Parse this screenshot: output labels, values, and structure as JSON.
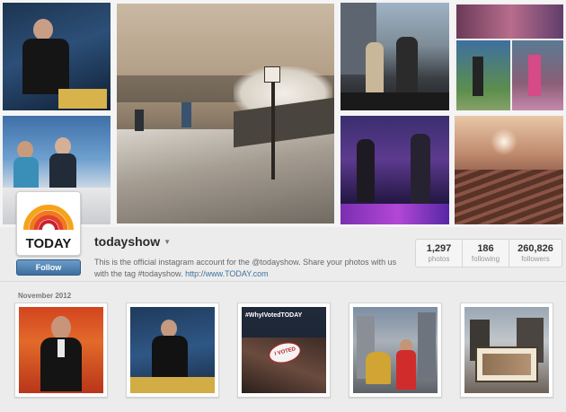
{
  "profile": {
    "username": "todayshow",
    "bio_text": "This is the official instagram account for the @todayshow. Share your photos with us with the tag #todayshow. ",
    "bio_link": "http://www.TODAY.com",
    "follow_label": "Follow",
    "avatar_logo_text": "TODAY"
  },
  "stats": [
    {
      "value": "1,297",
      "label": "photos"
    },
    {
      "value": "186",
      "label": "following"
    },
    {
      "value": "260,826",
      "label": "followers"
    }
  ],
  "section_label": "November 2012",
  "photos": [
    {
      "name": "photo-man-in-suit"
    },
    {
      "name": "photo-man-on-set"
    },
    {
      "name": "photo-why-i-voted",
      "caption": "#WhyIVotedTODAY",
      "sticker": "I VOTED"
    },
    {
      "name": "photo-woman-red-coat"
    },
    {
      "name": "photo-outdoor-crowd"
    }
  ],
  "colors": {
    "accent_link": "#3f729b",
    "follow_button": "#3d6f9f"
  }
}
